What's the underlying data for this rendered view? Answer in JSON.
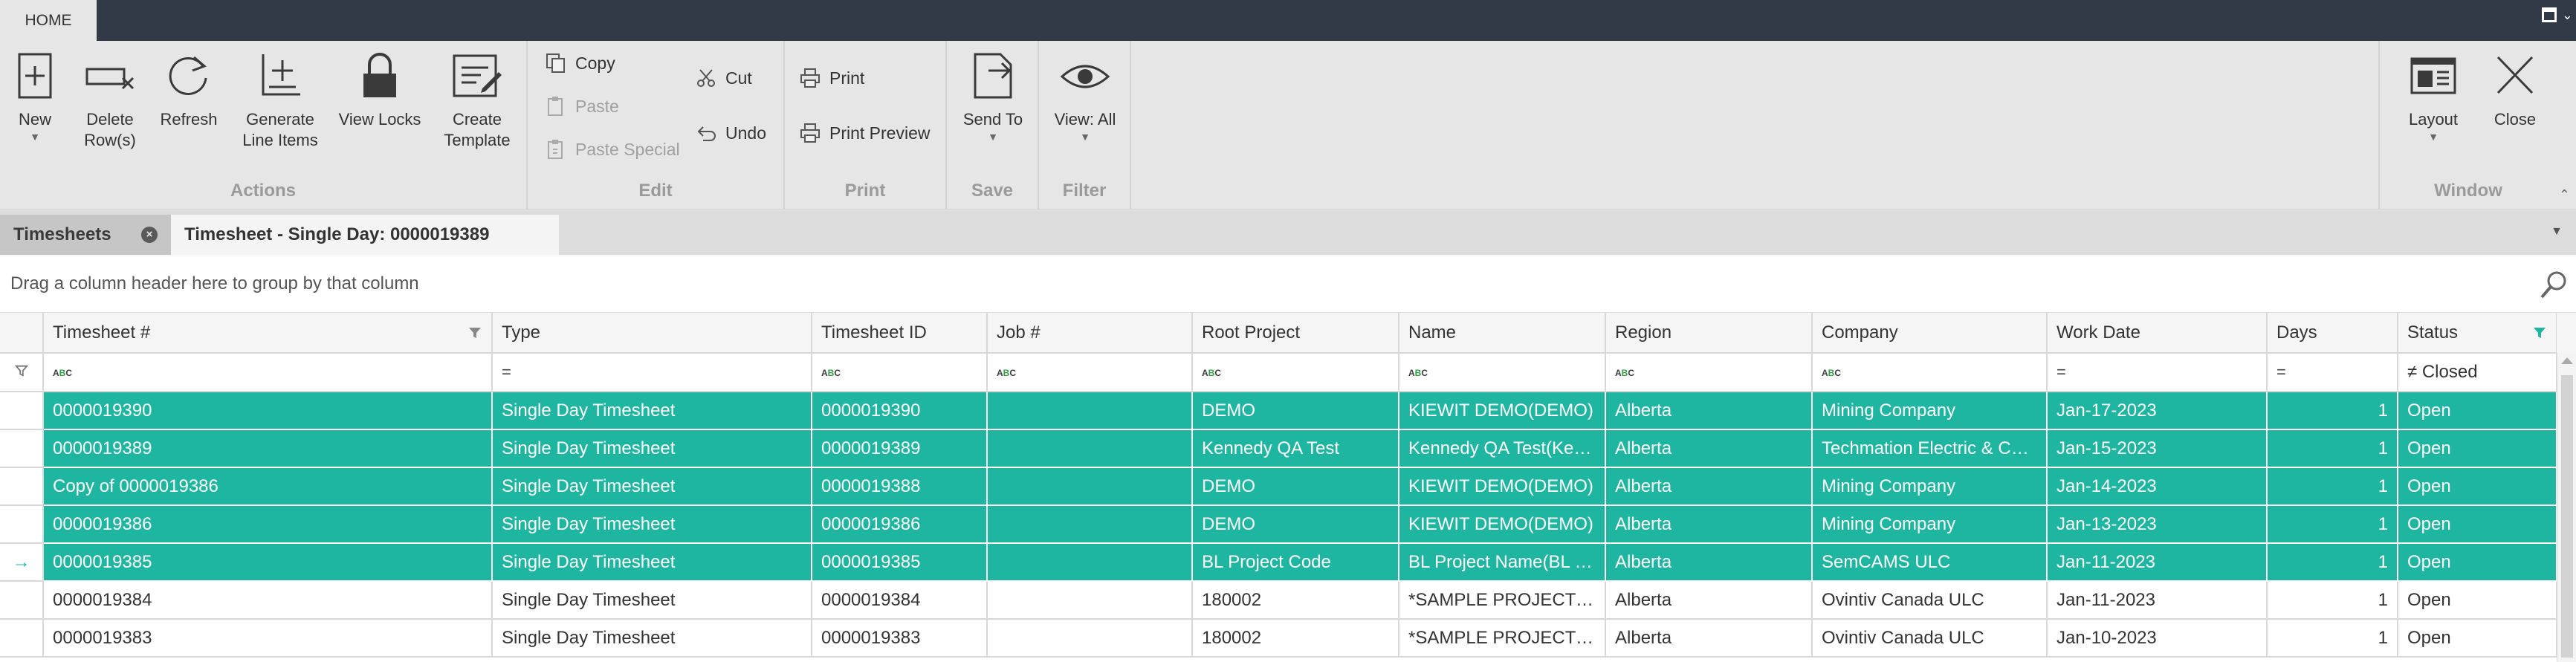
{
  "menu": {
    "home_tab": "HOME"
  },
  "ribbon": {
    "actions": {
      "label": "Actions",
      "new": "New",
      "delete": "Delete\nRow(s)",
      "refresh": "Refresh",
      "generate": "Generate\nLine Items",
      "view_locks": "View Locks",
      "create_template": "Create\nTemplate"
    },
    "edit": {
      "label": "Edit",
      "copy": "Copy",
      "paste": "Paste",
      "paste_special": "Paste Special",
      "cut": "Cut",
      "undo": "Undo"
    },
    "print": {
      "label": "Print",
      "print": "Print",
      "print_preview": "Print Preview"
    },
    "save": {
      "label": "Save",
      "send_to": "Send To"
    },
    "filter": {
      "label": "Filter",
      "view": "View: All"
    },
    "window": {
      "label": "Window",
      "layout": "Layout",
      "close": "Close"
    }
  },
  "tabs": [
    {
      "label": "Timesheets"
    },
    {
      "label": "Timesheet - Single Day: 0000019389"
    }
  ],
  "grid": {
    "group_hint": "Drag a column header here to group by that column",
    "columns": [
      "Timesheet #",
      "Type",
      "Timesheet ID",
      "Job #",
      "Root Project",
      "Name",
      "Region",
      "Company",
      "Work Date",
      "Days",
      "Status"
    ],
    "filter_row": {
      "text_op": "ABC",
      "eq_op": "=",
      "status_filter": "≠ Closed"
    },
    "rows": [
      {
        "timesheet_no": "0000019390",
        "type": "Single Day Timesheet",
        "timesheet_id": "0000019390",
        "job": "",
        "root_project": "DEMO",
        "name": "KIEWIT DEMO(DEMO)",
        "region": "Alberta",
        "company": "Mining Company",
        "work_date": "Jan-17-2023",
        "days": "1",
        "status": "Open"
      },
      {
        "timesheet_no": "0000019389",
        "type": "Single Day Timesheet",
        "timesheet_id": "0000019389",
        "job": "",
        "root_project": "Kennedy QA Test",
        "name": "Kennedy QA Test(Ken...",
        "region": "Alberta",
        "company": "Techmation Electric & Cont...",
        "work_date": "Jan-15-2023",
        "days": "1",
        "status": "Open"
      },
      {
        "timesheet_no": "Copy of 0000019386",
        "type": "Single Day Timesheet",
        "timesheet_id": "0000019388",
        "job": "",
        "root_project": "DEMO",
        "name": "KIEWIT DEMO(DEMO)",
        "region": "Alberta",
        "company": "Mining Company",
        "work_date": "Jan-14-2023",
        "days": "1",
        "status": "Open"
      },
      {
        "timesheet_no": "0000019386",
        "type": "Single Day Timesheet",
        "timesheet_id": "0000019386",
        "job": "",
        "root_project": "DEMO",
        "name": "KIEWIT DEMO(DEMO)",
        "region": "Alberta",
        "company": "Mining Company",
        "work_date": "Jan-13-2023",
        "days": "1",
        "status": "Open"
      },
      {
        "timesheet_no": "0000019385",
        "type": "Single Day Timesheet",
        "timesheet_id": "0000019385",
        "job": "",
        "root_project": "BL Project Code",
        "name": "BL Project Name(BL Pr...",
        "region": "Alberta",
        "company": "SemCAMS ULC",
        "work_date": "Jan-11-2023",
        "days": "1",
        "status": "Open"
      },
      {
        "timesheet_no": "0000019384",
        "type": "Single Day Timesheet",
        "timesheet_id": "0000019384",
        "job": "",
        "root_project": "180002",
        "name": "*SAMPLE PROJECT (1...",
        "region": "Alberta",
        "company": "Ovintiv Canada ULC",
        "work_date": "Jan-11-2023",
        "days": "1",
        "status": "Open"
      },
      {
        "timesheet_no": "0000019383",
        "type": "Single Day Timesheet",
        "timesheet_id": "0000019383",
        "job": "",
        "root_project": "180002",
        "name": "*SAMPLE PROJECT (1...",
        "region": "Alberta",
        "company": "Ovintiv Canada ULC",
        "work_date": "Jan-10-2023",
        "days": "1",
        "status": "Open"
      }
    ],
    "current_row_indicator": "→"
  },
  "colors": {
    "selection": "#1fb6a1",
    "titlebar": "#323a47",
    "ribbon": "#e6e6e6"
  }
}
